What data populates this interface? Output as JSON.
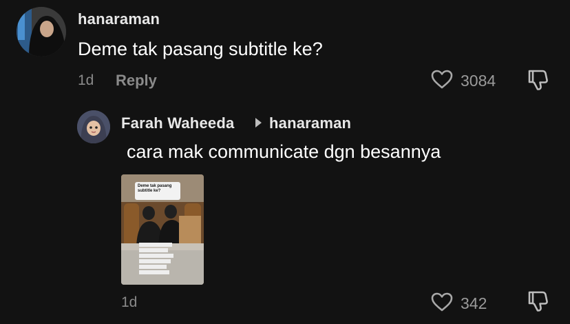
{
  "parent_comment": {
    "username": "hanaraman",
    "text": "Deme tak pasang subtitle ke?",
    "time": "1d",
    "reply_label": "Reply",
    "like_count": "3084"
  },
  "reply_comment": {
    "username": "Farah Waheeda",
    "reply_to": "hanaraman",
    "text": "cara mak communicate dgn besannya",
    "time": "1d",
    "like_count": "342",
    "video_thumbnail": {
      "caption_bubble": "Deme tak pasang subtitle ke?"
    }
  },
  "icons": {
    "like": "heart-outline-icon",
    "dislike": "thumbs-down-outline-icon",
    "reply_arrow": "caret-right-icon"
  },
  "colors": {
    "background": "#121212",
    "primary_text": "#ffffff",
    "secondary_text": "#8a8a8a"
  }
}
